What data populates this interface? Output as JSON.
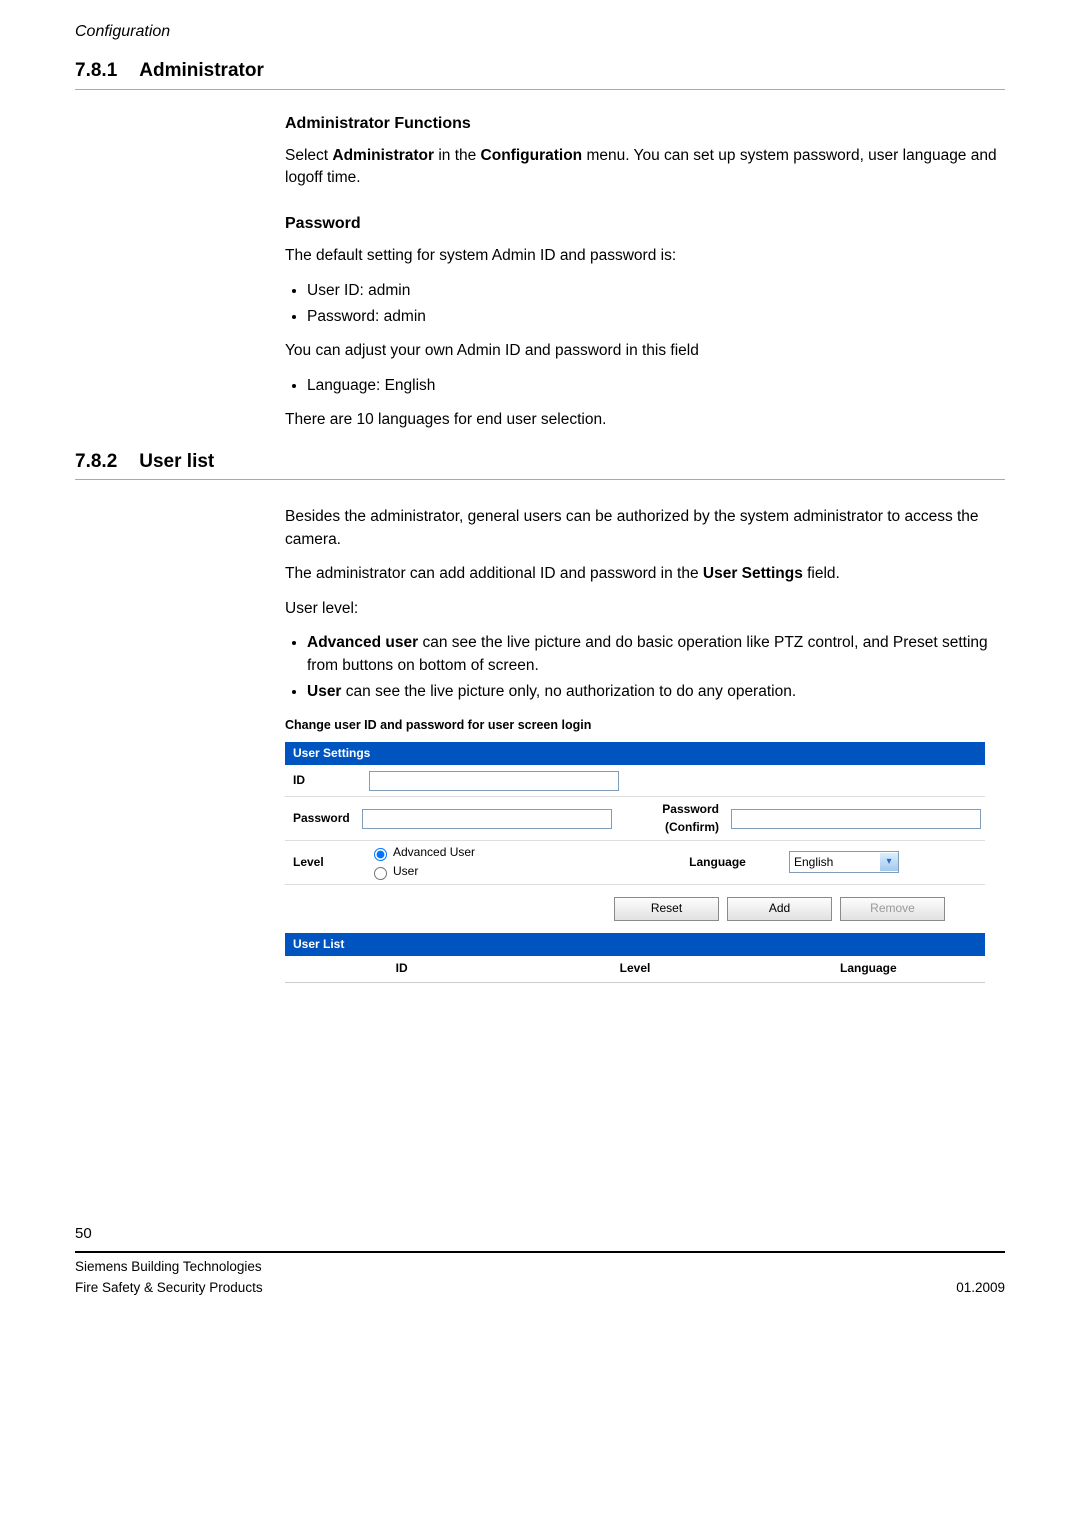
{
  "header": {
    "chapter": "Configuration"
  },
  "sections": {
    "s1": {
      "num": "7.8.1",
      "title": "Administrator"
    },
    "s2": {
      "num": "7.8.2",
      "title": "User list"
    }
  },
  "admin": {
    "h1": "Administrator Functions",
    "p1_a": "Select ",
    "p1_b": "Administrator",
    "p1_c": " in the ",
    "p1_d": "Configuration",
    "p1_e": " menu. You can set up system password, user language and logoff time.",
    "h2": "Password",
    "p2": "The default setting for system Admin ID and password is:",
    "bul1": "User ID: admin",
    "bul2": "Password: admin",
    "p3": "You can adjust your own Admin ID and password in this field",
    "bul3": "Language: English",
    "p4": "There are 10 languages for end user selection."
  },
  "userlist": {
    "p1": "Besides the administrator, general users can be authorized by the system administrator to access the camera.",
    "p2_a": "The administrator can add additional ID and password in the ",
    "p2_b": "User Settings",
    "p2_c": " field.",
    "p3": "User level:",
    "bul1_a": "Advanced user",
    "bul1_b": " can see the live picture and do basic operation like PTZ control, and Preset setting from buttons on bottom of screen.",
    "bul2_a": "User",
    "bul2_b": " can see the live picture only, no authorization to do any operation."
  },
  "form": {
    "caption": "Change user ID and password for user screen login",
    "title": "User Settings",
    "id_label": "ID",
    "pw_label": "Password",
    "pwc_label": "Password (Confirm)",
    "level_label": "Level",
    "level_opt1": "Advanced User",
    "level_opt2": "User",
    "lang_label": "Language",
    "lang_value": "English",
    "btn_reset": "Reset",
    "btn_add": "Add",
    "btn_remove": "Remove",
    "list_title": "User List",
    "col_id": "ID",
    "col_level": "Level",
    "col_lang": "Language"
  },
  "footer": {
    "page": "50",
    "line1": "Siemens Building Technologies",
    "line2": "Fire Safety & Security Products",
    "date": "01.2009"
  }
}
